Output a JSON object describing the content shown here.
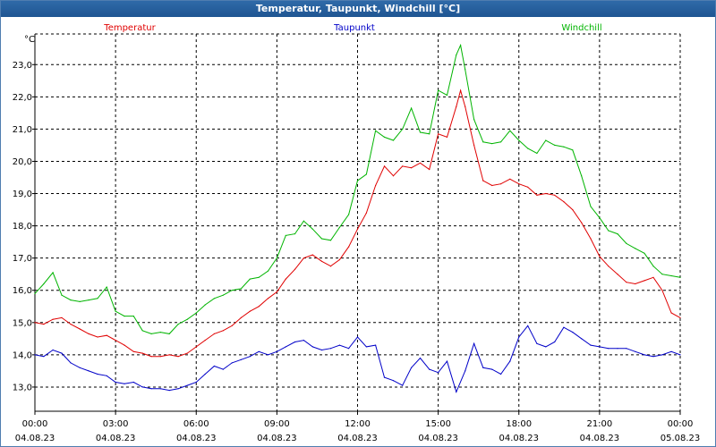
{
  "window": {
    "title": "Temperatur, Taupunkt, Windchill [°C]"
  },
  "chart_data": {
    "type": "line",
    "title": "Temperatur, Taupunkt, Windchill [°C]",
    "ylabel": "°C",
    "ylim": [
      12.25,
      23.95
    ],
    "yticks": [
      13.0,
      14.0,
      15.0,
      16.0,
      17.0,
      18.0,
      19.0,
      20.0,
      21.0,
      22.0,
      23.0
    ],
    "ytick_labels": [
      "13,0",
      "14,0",
      "15,0",
      "16,0",
      "17,0",
      "18,0",
      "19,0",
      "20,0",
      "21,0",
      "22,0",
      "23,0"
    ],
    "xlim": [
      0,
      24
    ],
    "xticks": [
      0,
      3,
      6,
      9,
      12,
      15,
      18,
      21,
      24
    ],
    "xtick_labels": [
      {
        "time": "00:00",
        "date": "04.08.23"
      },
      {
        "time": "03:00",
        "date": "04.08.23"
      },
      {
        "time": "06:00",
        "date": "04.08.23"
      },
      {
        "time": "09:00",
        "date": "04.08.23"
      },
      {
        "time": "12:00",
        "date": "04.08.23"
      },
      {
        "time": "15:00",
        "date": "04.08.23"
      },
      {
        "time": "18:00",
        "date": "04.08.23"
      },
      {
        "time": "21:00",
        "date": "04.08.23"
      },
      {
        "time": "00:00",
        "date": "05.08.23"
      }
    ],
    "grid": true,
    "legend_position": "top",
    "series": [
      {
        "name": "Temperatur",
        "color": "#e00000",
        "points": [
          [
            0.0,
            15.0
          ],
          [
            0.33,
            14.95
          ],
          [
            0.67,
            15.1
          ],
          [
            1.0,
            15.15
          ],
          [
            1.33,
            14.95
          ],
          [
            1.67,
            14.8
          ],
          [
            2.0,
            14.65
          ],
          [
            2.33,
            14.55
          ],
          [
            2.67,
            14.6
          ],
          [
            3.0,
            14.45
          ],
          [
            3.33,
            14.3
          ],
          [
            3.67,
            14.1
          ],
          [
            4.0,
            14.05
          ],
          [
            4.33,
            13.95
          ],
          [
            4.67,
            13.95
          ],
          [
            5.0,
            14.0
          ],
          [
            5.33,
            13.95
          ],
          [
            5.67,
            14.05
          ],
          [
            6.0,
            14.25
          ],
          [
            6.33,
            14.45
          ],
          [
            6.67,
            14.65
          ],
          [
            7.0,
            14.75
          ],
          [
            7.33,
            14.9
          ],
          [
            7.67,
            15.15
          ],
          [
            8.0,
            15.35
          ],
          [
            8.33,
            15.5
          ],
          [
            8.67,
            15.75
          ],
          [
            9.0,
            15.95
          ],
          [
            9.33,
            16.35
          ],
          [
            9.67,
            16.65
          ],
          [
            10.0,
            17.0
          ],
          [
            10.33,
            17.1
          ],
          [
            10.67,
            16.9
          ],
          [
            11.0,
            16.75
          ],
          [
            11.33,
            16.95
          ],
          [
            11.67,
            17.35
          ],
          [
            12.0,
            17.9
          ],
          [
            12.33,
            18.4
          ],
          [
            12.67,
            19.25
          ],
          [
            13.0,
            19.85
          ],
          [
            13.33,
            19.55
          ],
          [
            13.67,
            19.85
          ],
          [
            14.0,
            19.8
          ],
          [
            14.33,
            19.95
          ],
          [
            14.67,
            19.75
          ],
          [
            15.0,
            20.85
          ],
          [
            15.33,
            20.75
          ],
          [
            15.67,
            21.7
          ],
          [
            15.83,
            22.2
          ],
          [
            16.0,
            21.7
          ],
          [
            16.33,
            20.5
          ],
          [
            16.67,
            19.4
          ],
          [
            17.0,
            19.25
          ],
          [
            17.33,
            19.3
          ],
          [
            17.67,
            19.45
          ],
          [
            18.0,
            19.3
          ],
          [
            18.33,
            19.2
          ],
          [
            18.67,
            18.95
          ],
          [
            19.0,
            19.0
          ],
          [
            19.33,
            18.95
          ],
          [
            19.67,
            18.75
          ],
          [
            20.0,
            18.5
          ],
          [
            20.33,
            18.1
          ],
          [
            20.67,
            17.6
          ],
          [
            21.0,
            17.05
          ],
          [
            21.33,
            16.75
          ],
          [
            21.67,
            16.5
          ],
          [
            22.0,
            16.25
          ],
          [
            22.33,
            16.2
          ],
          [
            22.67,
            16.3
          ],
          [
            23.0,
            16.4
          ],
          [
            23.33,
            16.0
          ],
          [
            23.67,
            15.3
          ],
          [
            24.0,
            15.15
          ]
        ]
      },
      {
        "name": "Taupunkt",
        "color": "#0000c8",
        "points": [
          [
            0.0,
            14.0
          ],
          [
            0.33,
            13.95
          ],
          [
            0.67,
            14.15
          ],
          [
            1.0,
            14.05
          ],
          [
            1.33,
            13.75
          ],
          [
            1.67,
            13.6
          ],
          [
            2.0,
            13.5
          ],
          [
            2.33,
            13.4
          ],
          [
            2.67,
            13.35
          ],
          [
            3.0,
            13.15
          ],
          [
            3.33,
            13.1
          ],
          [
            3.67,
            13.15
          ],
          [
            4.0,
            13.0
          ],
          [
            4.33,
            12.95
          ],
          [
            4.67,
            12.95
          ],
          [
            5.0,
            12.9
          ],
          [
            5.33,
            12.95
          ],
          [
            5.67,
            13.05
          ],
          [
            6.0,
            13.15
          ],
          [
            6.33,
            13.4
          ],
          [
            6.67,
            13.65
          ],
          [
            7.0,
            13.55
          ],
          [
            7.33,
            13.75
          ],
          [
            7.67,
            13.85
          ],
          [
            8.0,
            13.95
          ],
          [
            8.33,
            14.1
          ],
          [
            8.67,
            14.0
          ],
          [
            9.0,
            14.1
          ],
          [
            9.33,
            14.25
          ],
          [
            9.67,
            14.4
          ],
          [
            10.0,
            14.45
          ],
          [
            10.33,
            14.25
          ],
          [
            10.67,
            14.15
          ],
          [
            11.0,
            14.2
          ],
          [
            11.33,
            14.3
          ],
          [
            11.67,
            14.2
          ],
          [
            12.0,
            14.55
          ],
          [
            12.33,
            14.25
          ],
          [
            12.67,
            14.3
          ],
          [
            13.0,
            13.3
          ],
          [
            13.33,
            13.2
          ],
          [
            13.67,
            13.05
          ],
          [
            14.0,
            13.6
          ],
          [
            14.33,
            13.9
          ],
          [
            14.67,
            13.55
          ],
          [
            15.0,
            13.45
          ],
          [
            15.33,
            13.8
          ],
          [
            15.67,
            12.85
          ],
          [
            16.0,
            13.5
          ],
          [
            16.33,
            14.35
          ],
          [
            16.67,
            13.6
          ],
          [
            17.0,
            13.55
          ],
          [
            17.33,
            13.4
          ],
          [
            17.67,
            13.8
          ],
          [
            18.0,
            14.55
          ],
          [
            18.33,
            14.9
          ],
          [
            18.67,
            14.35
          ],
          [
            19.0,
            14.25
          ],
          [
            19.33,
            14.4
          ],
          [
            19.67,
            14.85
          ],
          [
            20.0,
            14.7
          ],
          [
            20.33,
            14.5
          ],
          [
            20.67,
            14.3
          ],
          [
            21.0,
            14.25
          ],
          [
            21.33,
            14.2
          ],
          [
            21.67,
            14.2
          ],
          [
            22.0,
            14.2
          ],
          [
            22.33,
            14.1
          ],
          [
            22.67,
            14.0
          ],
          [
            23.0,
            13.95
          ],
          [
            23.33,
            14.0
          ],
          [
            23.67,
            14.1
          ],
          [
            24.0,
            14.0
          ]
        ]
      },
      {
        "name": "Windchill",
        "color": "#00b400",
        "points": [
          [
            0.0,
            15.9
          ],
          [
            0.33,
            16.2
          ],
          [
            0.67,
            16.55
          ],
          [
            1.0,
            15.85
          ],
          [
            1.33,
            15.7
          ],
          [
            1.67,
            15.65
          ],
          [
            2.0,
            15.7
          ],
          [
            2.33,
            15.75
          ],
          [
            2.67,
            16.1
          ],
          [
            3.0,
            15.35
          ],
          [
            3.33,
            15.2
          ],
          [
            3.67,
            15.2
          ],
          [
            4.0,
            14.75
          ],
          [
            4.33,
            14.65
          ],
          [
            4.67,
            14.7
          ],
          [
            5.0,
            14.65
          ],
          [
            5.33,
            14.95
          ],
          [
            5.67,
            15.1
          ],
          [
            6.0,
            15.3
          ],
          [
            6.33,
            15.55
          ],
          [
            6.67,
            15.75
          ],
          [
            7.0,
            15.85
          ],
          [
            7.33,
            16.0
          ],
          [
            7.67,
            16.05
          ],
          [
            8.0,
            16.35
          ],
          [
            8.33,
            16.4
          ],
          [
            8.67,
            16.6
          ],
          [
            9.0,
            17.0
          ],
          [
            9.33,
            17.7
          ],
          [
            9.67,
            17.75
          ],
          [
            10.0,
            18.15
          ],
          [
            10.33,
            17.9
          ],
          [
            10.67,
            17.6
          ],
          [
            11.0,
            17.55
          ],
          [
            11.33,
            17.95
          ],
          [
            11.67,
            18.35
          ],
          [
            12.0,
            19.4
          ],
          [
            12.33,
            19.6
          ],
          [
            12.67,
            20.95
          ],
          [
            13.0,
            20.75
          ],
          [
            13.33,
            20.65
          ],
          [
            13.67,
            21.0
          ],
          [
            14.0,
            21.65
          ],
          [
            14.33,
            20.9
          ],
          [
            14.67,
            20.85
          ],
          [
            15.0,
            22.2
          ],
          [
            15.33,
            22.05
          ],
          [
            15.67,
            23.3
          ],
          [
            15.83,
            23.6
          ],
          [
            16.0,
            22.85
          ],
          [
            16.33,
            21.3
          ],
          [
            16.67,
            20.6
          ],
          [
            17.0,
            20.55
          ],
          [
            17.33,
            20.6
          ],
          [
            17.67,
            20.95
          ],
          [
            18.0,
            20.65
          ],
          [
            18.33,
            20.4
          ],
          [
            18.67,
            20.25
          ],
          [
            19.0,
            20.65
          ],
          [
            19.33,
            20.5
          ],
          [
            19.67,
            20.45
          ],
          [
            20.0,
            20.35
          ],
          [
            20.33,
            19.55
          ],
          [
            20.67,
            18.6
          ],
          [
            21.0,
            18.25
          ],
          [
            21.33,
            17.85
          ],
          [
            21.67,
            17.75
          ],
          [
            22.0,
            17.45
          ],
          [
            22.33,
            17.3
          ],
          [
            22.67,
            17.15
          ],
          [
            23.0,
            16.75
          ],
          [
            23.33,
            16.5
          ],
          [
            23.67,
            16.45
          ],
          [
            24.0,
            16.4
          ]
        ]
      }
    ]
  }
}
